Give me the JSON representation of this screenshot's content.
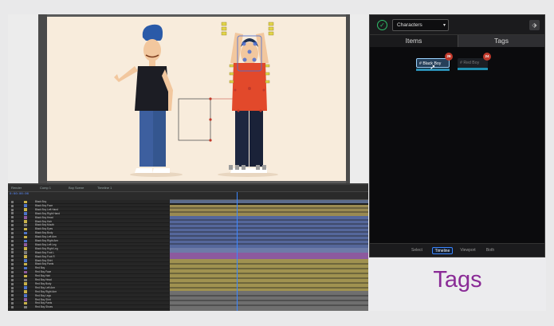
{
  "timeline": {
    "tabs": [
      "Render",
      "Comp 1",
      "Boy Scene",
      "Timeline 1"
    ],
    "timecode": "0:00:00:00",
    "layers": [
      "Black Boy",
      "Black Boy Face",
      "Black Boy Left Hand",
      "Black Boy Right Hand",
      "Black Boy Head",
      "Black Boy Hair",
      "Black Boy Mouth",
      "Black Boy Eyes",
      "Black Boy Body",
      "Black Boy Left Arm",
      "Black Boy Right Arm",
      "Black Boy Left Leg",
      "Black Boy Right Leg",
      "Black Boy Foot L",
      "Black Boy Foot R",
      "Black Boy Shirt",
      "Black Boy Pants",
      "Red Boy",
      "Red Boy Face",
      "Red Boy Hair",
      "Red Boy Head",
      "Red Boy Body",
      "Red Boy Left Arm",
      "Red Boy Right Arm",
      "Red Boy Legs",
      "Red Boy Shirt",
      "Red Boy Pants",
      "Red Boy Shoes"
    ]
  },
  "panel": {
    "dropdown_value": "Characters",
    "tabs": {
      "items": "Items",
      "tags": "Tags"
    },
    "tags": [
      {
        "label": "Black Boy",
        "count": "26",
        "color": "#2a8fb5"
      },
      {
        "label": "Red Boy",
        "count": "24",
        "color": "#1f8fb0"
      }
    ],
    "footer": {
      "select": "Select",
      "timeline": "Timeline",
      "viewport": "Viewport",
      "both": "Both"
    }
  },
  "caption": "Tags",
  "colors": {
    "accent": "#3a86ff",
    "caption": "#8a2b96",
    "badge": "#c0392b",
    "check": "#2fbf6a"
  }
}
